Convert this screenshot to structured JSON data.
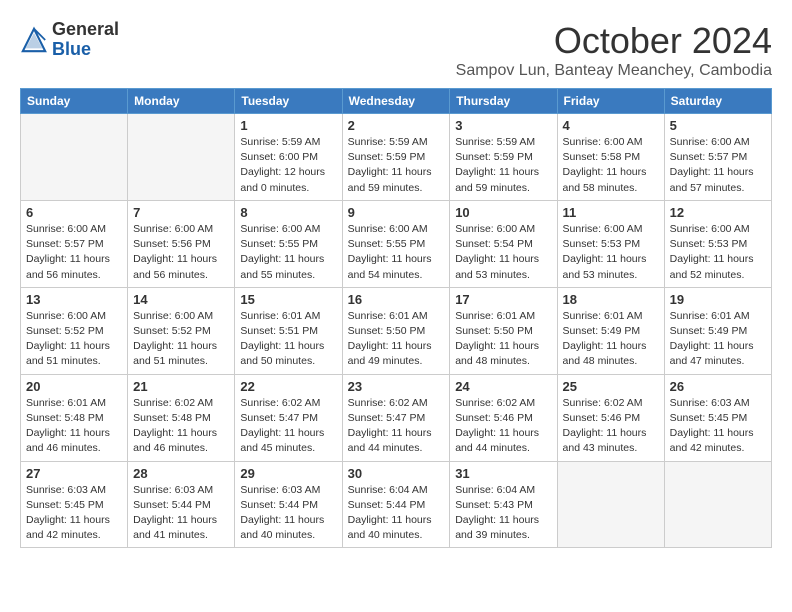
{
  "header": {
    "logo_general": "General",
    "logo_blue": "Blue",
    "month_year": "October 2024",
    "location": "Sampov Lun, Banteay Meanchey, Cambodia"
  },
  "columns": [
    "Sunday",
    "Monday",
    "Tuesday",
    "Wednesday",
    "Thursday",
    "Friday",
    "Saturday"
  ],
  "weeks": [
    [
      {
        "day": "",
        "info": ""
      },
      {
        "day": "",
        "info": ""
      },
      {
        "day": "1",
        "info": "Sunrise: 5:59 AM\nSunset: 6:00 PM\nDaylight: 12 hours\nand 0 minutes."
      },
      {
        "day": "2",
        "info": "Sunrise: 5:59 AM\nSunset: 5:59 PM\nDaylight: 11 hours\nand 59 minutes."
      },
      {
        "day": "3",
        "info": "Sunrise: 5:59 AM\nSunset: 5:59 PM\nDaylight: 11 hours\nand 59 minutes."
      },
      {
        "day": "4",
        "info": "Sunrise: 6:00 AM\nSunset: 5:58 PM\nDaylight: 11 hours\nand 58 minutes."
      },
      {
        "day": "5",
        "info": "Sunrise: 6:00 AM\nSunset: 5:57 PM\nDaylight: 11 hours\nand 57 minutes."
      }
    ],
    [
      {
        "day": "6",
        "info": "Sunrise: 6:00 AM\nSunset: 5:57 PM\nDaylight: 11 hours\nand 56 minutes."
      },
      {
        "day": "7",
        "info": "Sunrise: 6:00 AM\nSunset: 5:56 PM\nDaylight: 11 hours\nand 56 minutes."
      },
      {
        "day": "8",
        "info": "Sunrise: 6:00 AM\nSunset: 5:55 PM\nDaylight: 11 hours\nand 55 minutes."
      },
      {
        "day": "9",
        "info": "Sunrise: 6:00 AM\nSunset: 5:55 PM\nDaylight: 11 hours\nand 54 minutes."
      },
      {
        "day": "10",
        "info": "Sunrise: 6:00 AM\nSunset: 5:54 PM\nDaylight: 11 hours\nand 53 minutes."
      },
      {
        "day": "11",
        "info": "Sunrise: 6:00 AM\nSunset: 5:53 PM\nDaylight: 11 hours\nand 53 minutes."
      },
      {
        "day": "12",
        "info": "Sunrise: 6:00 AM\nSunset: 5:53 PM\nDaylight: 11 hours\nand 52 minutes."
      }
    ],
    [
      {
        "day": "13",
        "info": "Sunrise: 6:00 AM\nSunset: 5:52 PM\nDaylight: 11 hours\nand 51 minutes."
      },
      {
        "day": "14",
        "info": "Sunrise: 6:00 AM\nSunset: 5:52 PM\nDaylight: 11 hours\nand 51 minutes."
      },
      {
        "day": "15",
        "info": "Sunrise: 6:01 AM\nSunset: 5:51 PM\nDaylight: 11 hours\nand 50 minutes."
      },
      {
        "day": "16",
        "info": "Sunrise: 6:01 AM\nSunset: 5:50 PM\nDaylight: 11 hours\nand 49 minutes."
      },
      {
        "day": "17",
        "info": "Sunrise: 6:01 AM\nSunset: 5:50 PM\nDaylight: 11 hours\nand 48 minutes."
      },
      {
        "day": "18",
        "info": "Sunrise: 6:01 AM\nSunset: 5:49 PM\nDaylight: 11 hours\nand 48 minutes."
      },
      {
        "day": "19",
        "info": "Sunrise: 6:01 AM\nSunset: 5:49 PM\nDaylight: 11 hours\nand 47 minutes."
      }
    ],
    [
      {
        "day": "20",
        "info": "Sunrise: 6:01 AM\nSunset: 5:48 PM\nDaylight: 11 hours\nand 46 minutes."
      },
      {
        "day": "21",
        "info": "Sunrise: 6:02 AM\nSunset: 5:48 PM\nDaylight: 11 hours\nand 46 minutes."
      },
      {
        "day": "22",
        "info": "Sunrise: 6:02 AM\nSunset: 5:47 PM\nDaylight: 11 hours\nand 45 minutes."
      },
      {
        "day": "23",
        "info": "Sunrise: 6:02 AM\nSunset: 5:47 PM\nDaylight: 11 hours\nand 44 minutes."
      },
      {
        "day": "24",
        "info": "Sunrise: 6:02 AM\nSunset: 5:46 PM\nDaylight: 11 hours\nand 44 minutes."
      },
      {
        "day": "25",
        "info": "Sunrise: 6:02 AM\nSunset: 5:46 PM\nDaylight: 11 hours\nand 43 minutes."
      },
      {
        "day": "26",
        "info": "Sunrise: 6:03 AM\nSunset: 5:45 PM\nDaylight: 11 hours\nand 42 minutes."
      }
    ],
    [
      {
        "day": "27",
        "info": "Sunrise: 6:03 AM\nSunset: 5:45 PM\nDaylight: 11 hours\nand 42 minutes."
      },
      {
        "day": "28",
        "info": "Sunrise: 6:03 AM\nSunset: 5:44 PM\nDaylight: 11 hours\nand 41 minutes."
      },
      {
        "day": "29",
        "info": "Sunrise: 6:03 AM\nSunset: 5:44 PM\nDaylight: 11 hours\nand 40 minutes."
      },
      {
        "day": "30",
        "info": "Sunrise: 6:04 AM\nSunset: 5:44 PM\nDaylight: 11 hours\nand 40 minutes."
      },
      {
        "day": "31",
        "info": "Sunrise: 6:04 AM\nSunset: 5:43 PM\nDaylight: 11 hours\nand 39 minutes."
      },
      {
        "day": "",
        "info": ""
      },
      {
        "day": "",
        "info": ""
      }
    ]
  ]
}
